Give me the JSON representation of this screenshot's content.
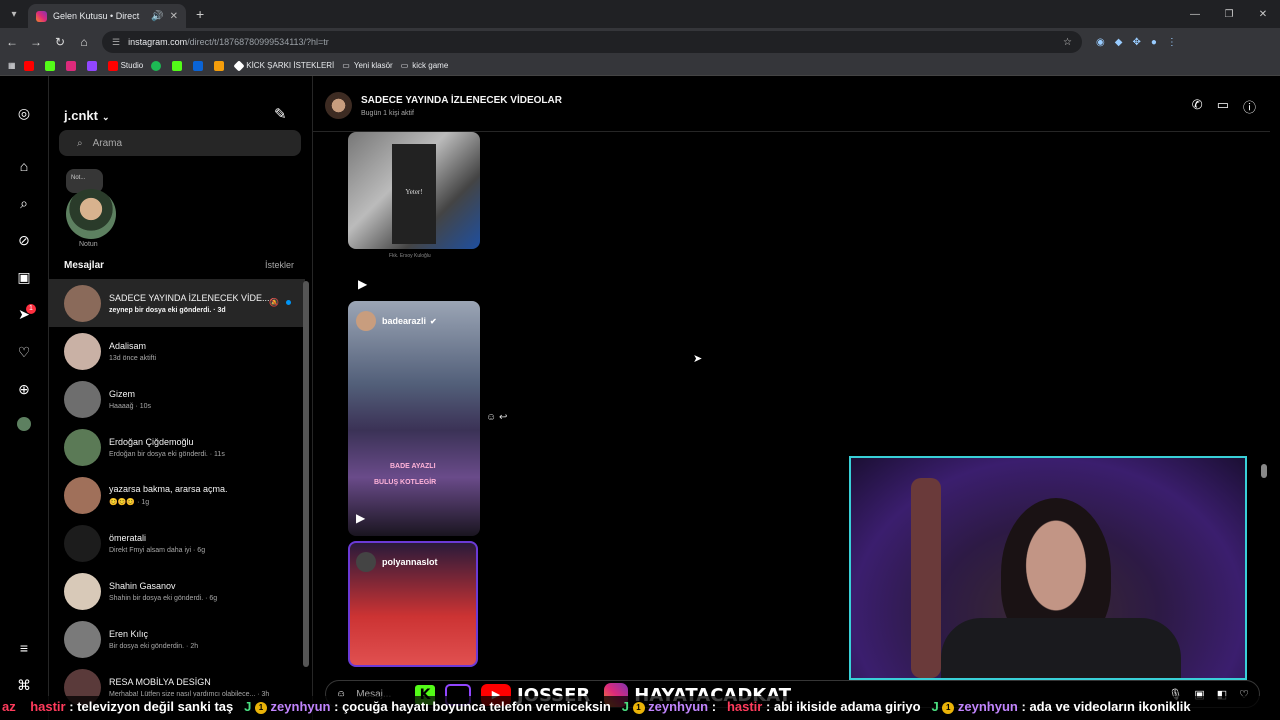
{
  "browser": {
    "tab_title": "Gelen Kutusu • Direct",
    "url_host": "instagram.com",
    "url_path": "/direct/t/18768780999534113/?hl=tr",
    "bookmarks": [
      "Studio",
      "KİCK ŞARKI İSTEKLERİ",
      "Yeni klasör",
      "kick game"
    ]
  },
  "instagram": {
    "username": "j.cnkt",
    "search_placeholder": "Arama",
    "note_bubble": "Not...",
    "note_label": "Notun",
    "messages_header": "Mesajlar",
    "requests_link": "İstekler",
    "notification_count": "1",
    "conversations": [
      {
        "name": "SADECE YAYINDA İZLENECEK VİDE...",
        "snippet": "zeynep bir dosya eki gönderdi. · 3d",
        "avatar_color": "#8a6a5a"
      },
      {
        "name": "Adalisam",
        "snippet": "13d önce aktifti",
        "avatar_color": "#c9b1a5"
      },
      {
        "name": "Gizem",
        "snippet": "Haaaağ · 10s",
        "avatar_color": "#6e6e6e"
      },
      {
        "name": "Erdoğan Çiğdemoğlu",
        "snippet": "Erdoğan bir dosya eki gönderdi. · 11s",
        "avatar_color": "#5b7a56"
      },
      {
        "name": "yazarsa bakma, ararsa açma.",
        "snippet": "😊😊😊 · 1g",
        "avatar_color": "#a0705a"
      },
      {
        "name": "ömeratali",
        "snippet": "Direkt Fmyi alsam daha iyi · 6g",
        "avatar_color": "#1c1c1c"
      },
      {
        "name": "Shahin Gasanov",
        "snippet": "Shahin bir dosya eki gönderdi. · 6g",
        "avatar_color": "#d8c9b8"
      },
      {
        "name": "Eren Kılıç",
        "snippet": "Bir dosya eki gönderdin. · 2h",
        "avatar_color": "#7a7a7a"
      },
      {
        "name": "RESA MOBİLYA DESİGN",
        "snippet": "Merhaba! Lütfen size nasıl yardımcı olabilece... · 3h",
        "avatar_color": "#5a3a3a"
      }
    ]
  },
  "chat": {
    "title": "SADECE YAYINDA İZLENECEK VİDEOLAR",
    "subtitle": "Bugün 1 kişi aktif",
    "media1_sign": "Yeter!",
    "media1_caption": "Fkk. Ersoy Kuloğlu",
    "media2_user": "badearazli",
    "media2_overlay1": "BADE AYAZLI",
    "media2_overlay2": "BULUŞ KOTLEGİR",
    "media3_user": "polyannaslot",
    "composer_placeholder": "Mesaj..."
  },
  "overlay": {
    "channel_name": "JOSSER",
    "instagram_handle": "HAYATACADKAT",
    "ticker": [
      {
        "user": "az",
        "text": ""
      },
      {
        "user": "hastir",
        "text": ": televizyon değil sanki taş"
      },
      {
        "user": "zeynhyun",
        "text": ": çocuğa hayatı boyunca telefon vermiceksin"
      },
      {
        "user": "zeynhyun",
        "text": ":"
      },
      {
        "user": "hastir",
        "text": ": abi ikiside adama giriyo"
      },
      {
        "user": "zeynhyun",
        "text": ": ada ve videoların ikoniklik"
      }
    ]
  },
  "colors": {
    "accent": "#0095f6",
    "notification": "#ff3040",
    "webcam_border": "#39d0d8"
  }
}
